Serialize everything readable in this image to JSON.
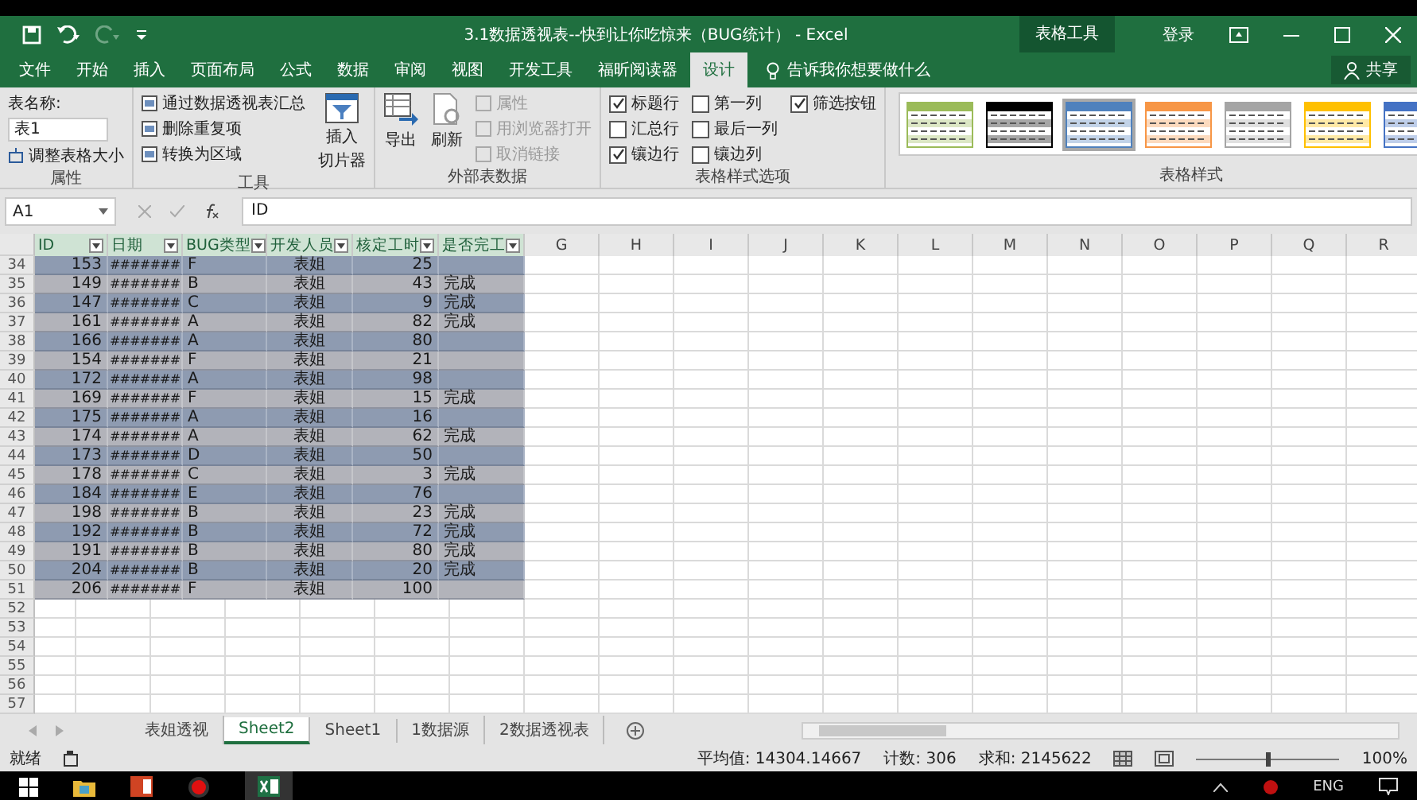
{
  "window": {
    "title": "3.1数据透视表--快到让你吃惊来（BUG统计） - Excel",
    "context_tab": "表格工具",
    "sign_in": "登录"
  },
  "ribbon_tabs": [
    {
      "label": "文件",
      "selected": false
    },
    {
      "label": "开始",
      "selected": false
    },
    {
      "label": "插入",
      "selected": false
    },
    {
      "label": "页面布局",
      "selected": false
    },
    {
      "label": "公式",
      "selected": false
    },
    {
      "label": "数据",
      "selected": false
    },
    {
      "label": "审阅",
      "selected": false
    },
    {
      "label": "视图",
      "selected": false
    },
    {
      "label": "开发工具",
      "selected": false
    },
    {
      "label": "福昕阅读器",
      "selected": false
    },
    {
      "label": "设计",
      "selected": true
    }
  ],
  "tell_me": "告诉我你想要做什么",
  "share": "共享",
  "properties_group": {
    "label": "属性",
    "table_name_label": "表名称:",
    "table_name": "表1",
    "resize": "调整表格大小"
  },
  "tools_group": {
    "label": "工具",
    "items": [
      "通过数据透视表汇总",
      "删除重复项",
      "转换为区域"
    ],
    "slicer_lines": [
      "插入",
      "切片器"
    ]
  },
  "external_group": {
    "label": "外部表数据",
    "export": "导出",
    "refresh": "刷新",
    "items": [
      {
        "label": "属性",
        "disabled": true
      },
      {
        "label": "用浏览器打开",
        "disabled": true
      },
      {
        "label": "取消链接",
        "disabled": true
      }
    ]
  },
  "style_options": {
    "label": "表格样式选项",
    "options": [
      {
        "label": "标题行",
        "checked": true
      },
      {
        "label": "汇总行",
        "checked": false
      },
      {
        "label": "镶边行",
        "checked": true
      },
      {
        "label": "第一列",
        "checked": false
      },
      {
        "label": "最后一列",
        "checked": false
      },
      {
        "label": "镶边列",
        "checked": false
      },
      {
        "label": "筛选按钮",
        "checked": true
      }
    ]
  },
  "table_styles": {
    "label": "表格样式",
    "styles": [
      {
        "color": "#9bbb59",
        "selected": false
      },
      {
        "color": "#000000",
        "selected": false
      },
      {
        "color": "#4f81bd",
        "selected": true
      },
      {
        "color": "#f79646",
        "selected": false
      },
      {
        "color": "#a5a5a5",
        "selected": false
      },
      {
        "color": "#ffc000",
        "selected": false
      },
      {
        "color": "#4472c4",
        "selected": false
      }
    ]
  },
  "formula_bar": {
    "name_box": "A1",
    "formula": "ID"
  },
  "sheet": {
    "columns": [
      "ID",
      "日期",
      "BUG类型",
      "开发人员",
      "核定工时",
      "是否完工"
    ],
    "extra_columns": [
      "G",
      "H",
      "I",
      "J",
      "K",
      "L",
      "M",
      "N",
      "O",
      "P",
      "Q",
      "R"
    ],
    "rows": [
      {
        "number": "34",
        "id": "153",
        "date": "#######",
        "type": "F",
        "developer": "表姐",
        "hours": "25"
      },
      {
        "number": "35",
        "id": "149",
        "date": "#######",
        "type": "B",
        "developer": "表姐",
        "hours": "43",
        "done": "完成"
      },
      {
        "number": "36",
        "id": "147",
        "date": "#######",
        "type": "C",
        "developer": "表姐",
        "hours": "9",
        "done": "完成"
      },
      {
        "number": "37",
        "id": "161",
        "date": "#######",
        "type": "A",
        "developer": "表姐",
        "hours": "82",
        "done": "完成"
      },
      {
        "number": "38",
        "id": "166",
        "date": "#######",
        "type": "A",
        "developer": "表姐",
        "hours": "80"
      },
      {
        "number": "39",
        "id": "154",
        "date": "#######",
        "type": "F",
        "developer": "表姐",
        "hours": "21"
      },
      {
        "number": "40",
        "id": "172",
        "date": "#######",
        "type": "A",
        "developer": "表姐",
        "hours": "98"
      },
      {
        "number": "41",
        "id": "169",
        "date": "#######",
        "type": "F",
        "developer": "表姐",
        "hours": "15",
        "done": "完成"
      },
      {
        "number": "42",
        "id": "175",
        "date": "#######",
        "type": "A",
        "developer": "表姐",
        "hours": "16"
      },
      {
        "number": "43",
        "id": "174",
        "date": "#######",
        "type": "A",
        "developer": "表姐",
        "hours": "62",
        "done": "完成"
      },
      {
        "number": "44",
        "id": "173",
        "date": "#######",
        "type": "D",
        "developer": "表姐",
        "hours": "50"
      },
      {
        "number": "45",
        "id": "178",
        "date": "#######",
        "type": "C",
        "developer": "表姐",
        "hours": "3",
        "done": "完成"
      },
      {
        "number": "46",
        "id": "184",
        "date": "#######",
        "type": "E",
        "developer": "表姐",
        "hours": "76"
      },
      {
        "number": "47",
        "id": "198",
        "date": "#######",
        "type": "B",
        "developer": "表姐",
        "hours": "23",
        "done": "完成"
      },
      {
        "number": "48",
        "id": "192",
        "date": "#######",
        "type": "B",
        "developer": "表姐",
        "hours": "72",
        "done": "完成"
      },
      {
        "number": "49",
        "id": "191",
        "date": "#######",
        "type": "B",
        "developer": "表姐",
        "hours": "80",
        "done": "完成"
      },
      {
        "number": "50",
        "id": "204",
        "date": "#######",
        "type": "B",
        "developer": "表姐",
        "hours": "20",
        "done": "完成"
      },
      {
        "number": "51",
        "id": "206",
        "date": "#######",
        "type": "F",
        "developer": "表姐",
        "hours": "100"
      }
    ],
    "empty_rows": [
      "52",
      "53",
      "54",
      "55",
      "56",
      "57"
    ]
  },
  "sheet_tabs": [
    {
      "label": "表姐透视",
      "selected": false
    },
    {
      "label": "Sheet2",
      "selected": true
    },
    {
      "label": "Sheet1",
      "selected": false
    },
    {
      "label": "1数据源",
      "selected": false
    },
    {
      "label": "2数据透视表",
      "selected": false
    }
  ],
  "status_bar": {
    "ready": "就绪",
    "average": "平均值: 14304.14667",
    "count": "计数: 306",
    "sum": "求和: 2145622",
    "zoom": "100%",
    "zoom_slider": {
      "level": 0.5
    }
  },
  "taskbar": {
    "language": "ENG"
  }
}
